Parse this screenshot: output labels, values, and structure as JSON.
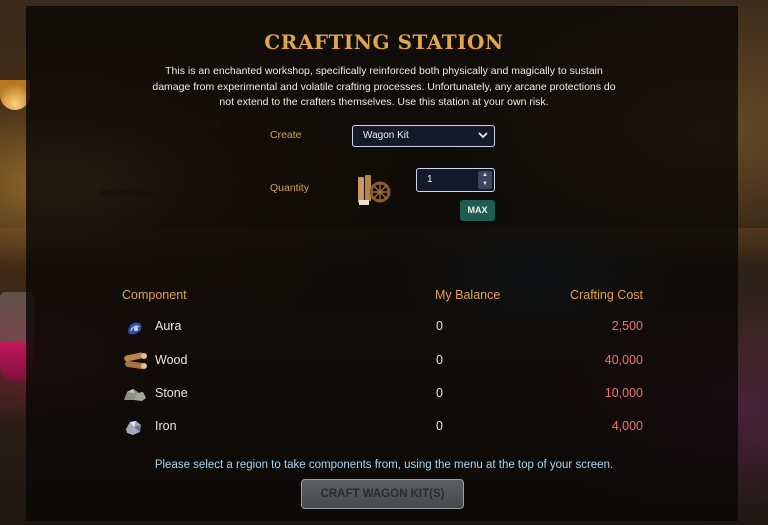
{
  "title": "CRAFTING STATION",
  "description": "This is an enchanted workshop, specifically reinforced both physically and magically to sustain damage from experimental and volatile crafting processes. Unfortunately, any arcane protections do not extend to the crafters themselves. Use this station at your own risk.",
  "form": {
    "create_label": "Create",
    "create_value": "Wagon Kit",
    "quantity_label": "Quantity",
    "quantity_value": "1",
    "max_label": "MAX",
    "item_icon": "wagon-kit-icon"
  },
  "table": {
    "headers": {
      "component": "Component",
      "balance": "My Balance",
      "cost": "Crafting Cost"
    },
    "rows": [
      {
        "icon": "aura-icon",
        "name": "Aura",
        "balance": "0",
        "cost": "2,500"
      },
      {
        "icon": "wood-icon",
        "name": "Wood",
        "balance": "0",
        "cost": "40,000"
      },
      {
        "icon": "stone-icon",
        "name": "Stone",
        "balance": "0",
        "cost": "10,000"
      },
      {
        "icon": "iron-icon",
        "name": "Iron",
        "balance": "0",
        "cost": "4,000"
      }
    ]
  },
  "notice": "Please select a region to take components from, using the menu at the top of your screen.",
  "craft_button": "CRAFT WAGON KIT(S)",
  "colors": {
    "accent": "#e2a649",
    "cost_insufficient": "#f0756b",
    "notice": "#a9d5f0",
    "max_button": "#1f5c52"
  }
}
